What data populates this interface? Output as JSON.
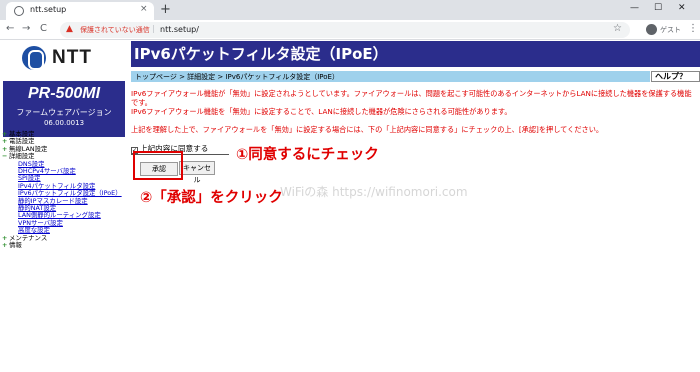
{
  "browser": {
    "tab_title": "ntt.setup",
    "tab_close": "×",
    "new_tab": "+",
    "win_min": "—",
    "win_max": "☐",
    "win_close": "✕",
    "back": "←",
    "forward": "→",
    "reload": "C",
    "insecure_label": "保護されていない通信",
    "url": "ntt.setup/",
    "star": "☆",
    "profile_label": "ゲスト",
    "menu": "⋮"
  },
  "sidebar": {
    "logo_text": "NTT",
    "model": "PR-500MI",
    "fw_label": "ファームウェアバージョン",
    "fw_version": "06.00.0013",
    "items": [
      {
        "pm": "+",
        "label": "基本設定"
      },
      {
        "pm": "+",
        "label": "電話設定"
      },
      {
        "pm": "+",
        "label": "無線LAN設定"
      },
      {
        "pm": "−",
        "label": "詳細設定"
      }
    ],
    "subitems": [
      "DNS設定",
      "DHCPv4サーバ設定",
      "SPI設定",
      "IPv4パケットフィルタ設定",
      "IPv6パケットフィルタ設定（IPoE）",
      "静的IPマスカレード設定",
      "静的NAT設定",
      "LAN側静的ルーティング設定",
      "VPNサーバ設定",
      "高度な設定"
    ],
    "items_after": [
      {
        "pm": "+",
        "label": "メンテナンス"
      },
      {
        "pm": "+",
        "label": "情報"
      }
    ]
  },
  "main": {
    "title": "IPv6パケットフィルタ設定（IPoE）",
    "breadcrumb": "トップページ > 詳細設定 > IPv6パケットフィルタ設定（IPoE）",
    "help": "ヘルプ？",
    "warning_1": "IPv6ファイアウォール機能が「無効」に設定されようとしています。ファイアウォールは、問題を起こす可能性のあるインターネットからLANに接続した機器を保護する機能です。",
    "warning_2": "IPv6ファイアウォール機能を「無効」に設定することで、LANに接続した機器が危険にさらされる可能性があります。",
    "confirm_text": "上記を理解した上で、ファイアウォールを「無効」に設定する場合には、下の「上記内容に同意する」にチェックの上、[承認]を押してください。",
    "checkbox_mark": "✓",
    "agree_label": "上記内容に同意する",
    "approve_button": "承認",
    "cancel_button": "キャンセル"
  },
  "annotations": {
    "step1": "①同意するにチェック",
    "step2": "②「承認」をクリック",
    "watermark": "WiFiの森 https://wifinomori.com"
  },
  "colors": {
    "header_bg": "#2b2d8c",
    "breadcrumb_bg": "#9fd1ec",
    "warning_text": "#e00000",
    "annotation": "#e00000"
  }
}
